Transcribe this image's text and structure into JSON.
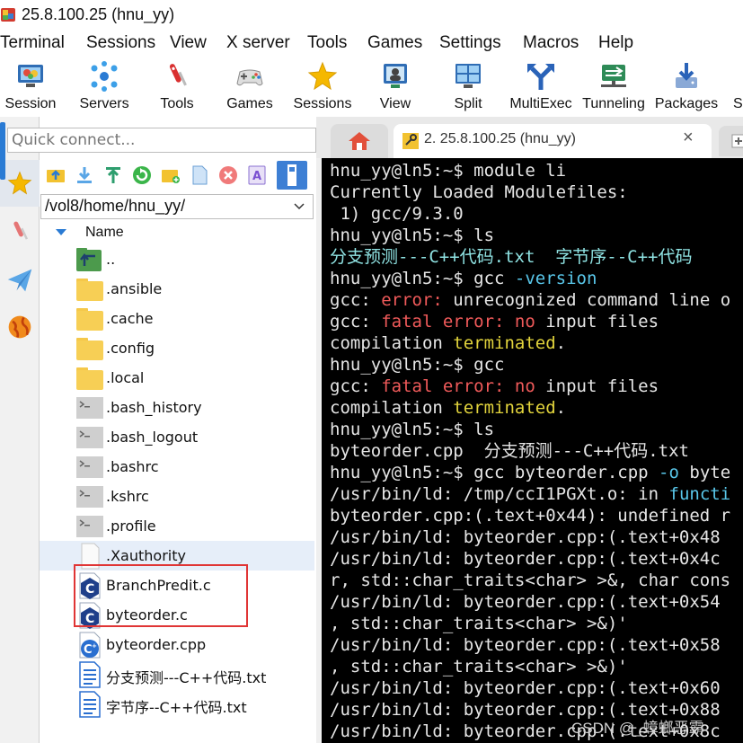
{
  "window": {
    "title": "25.8.100.25 (hnu_yy)"
  },
  "menu": [
    "Terminal",
    "Sessions",
    "View",
    "X server",
    "Tools",
    "Games",
    "Settings",
    "Macros",
    "Help"
  ],
  "toolbar": {
    "session": "Session",
    "servers": "Servers",
    "tools": "Tools",
    "games": "Games",
    "sessions": "Sessions",
    "view": "View",
    "split": "Split",
    "multiexec": "MultiExec",
    "tunneling": "Tunneling",
    "packages": "Packages",
    "more": "S"
  },
  "quick_connect": {
    "placeholder": "Quick connect..."
  },
  "file_panel": {
    "path": "/vol8/home/hnu_yy/",
    "column_header": "Name",
    "files": [
      {
        "name": "..",
        "type": "parent"
      },
      {
        "name": ".ansible",
        "type": "folder"
      },
      {
        "name": ".cache",
        "type": "folder"
      },
      {
        "name": ".config",
        "type": "folder"
      },
      {
        "name": ".local",
        "type": "folder"
      },
      {
        "name": ".bash_history",
        "type": "script"
      },
      {
        "name": ".bash_logout",
        "type": "script"
      },
      {
        "name": ".bashrc",
        "type": "script"
      },
      {
        "name": ".kshrc",
        "type": "script"
      },
      {
        "name": ".profile",
        "type": "script"
      },
      {
        "name": ".Xauthority",
        "type": "blank"
      },
      {
        "name": "BranchPredit.c",
        "type": "c"
      },
      {
        "name": "byteorder.c",
        "type": "c"
      },
      {
        "name": "byteorder.cpp",
        "type": "cpp"
      },
      {
        "name": "分支预测---C++代码.txt",
        "type": "txt"
      },
      {
        "name": "字节序--C++代码.txt",
        "type": "txt"
      }
    ]
  },
  "tabs": {
    "active_label": "2. 25.8.100.25 (hnu_yy)",
    "close_glyph": "×"
  },
  "terminal": {
    "lines": [
      [
        [
          "hnu_yy@ln5:~$ module li",
          ""
        ]
      ],
      [
        [
          "Currently Loaded Modulefiles:",
          ""
        ]
      ],
      [
        [
          " 1) gcc/9.3.0",
          ""
        ]
      ],
      [
        [
          "hnu_yy@ln5:~$ ls",
          ""
        ]
      ],
      [
        [
          "分支预测---C++代码.txt  字节序--C++代码",
          "teal"
        ]
      ],
      [
        [
          "hnu_yy@ln5:~$ gcc ",
          ""
        ],
        [
          "-version",
          "cyan"
        ]
      ],
      [
        [
          "gcc: ",
          ""
        ],
        [
          "error:",
          "red"
        ],
        [
          " unrecognized command line o",
          ""
        ]
      ],
      [
        [
          "gcc: ",
          ""
        ],
        [
          "fatal error: no",
          "red"
        ],
        [
          " input files",
          ""
        ]
      ],
      [
        [
          "compilation ",
          ""
        ],
        [
          "terminated",
          "yellow"
        ],
        [
          ".",
          ""
        ]
      ],
      [
        [
          "hnu_yy@ln5:~$ gcc",
          ""
        ]
      ],
      [
        [
          "gcc: ",
          ""
        ],
        [
          "fatal error: no",
          "red"
        ],
        [
          " input files",
          ""
        ]
      ],
      [
        [
          "compilation ",
          ""
        ],
        [
          "terminated",
          "yellow"
        ],
        [
          ".",
          ""
        ]
      ],
      [
        [
          "hnu_yy@ln5:~$ ls",
          ""
        ]
      ],
      [
        [
          "byteorder.cpp  分支预测---C++代码.txt  ",
          ""
        ]
      ],
      [
        [
          "hnu_yy@ln5:~$ gcc byteorder.cpp ",
          ""
        ],
        [
          "-o",
          "cyan"
        ],
        [
          " byte",
          ""
        ]
      ],
      [
        [
          "/usr/bin/ld: /tmp/ccI1PGXt.o: in ",
          ""
        ],
        [
          "functi",
          "cyan"
        ]
      ],
      [
        [
          "byteorder.cpp:(.text+0x44): undefined r",
          ""
        ]
      ],
      [
        [
          "/usr/bin/ld: byteorder.cpp:(.text+0x48",
          ""
        ]
      ],
      [
        [
          "/usr/bin/ld: byteorder.cpp:(.text+0x4c",
          ""
        ]
      ],
      [
        [
          "r, std::char_traits<char> >&, char cons",
          ""
        ]
      ],
      [
        [
          "/usr/bin/ld: byteorder.cpp:(.text+0x54",
          ""
        ]
      ],
      [
        [
          ", std::char_traits<char> >&)'",
          ""
        ]
      ],
      [
        [
          "/usr/bin/ld: byteorder.cpp:(.text+0x58",
          ""
        ]
      ],
      [
        [
          ", std::char_traits<char> >&)'",
          ""
        ]
      ],
      [
        [
          "/usr/bin/ld: byteorder.cpp:(.text+0x60",
          ""
        ]
      ],
      [
        [
          "/usr/bin/ld: byteorder.cpp:(.text+0x88",
          ""
        ]
      ],
      [
        [
          "/usr/bin/ld: byteorder.cpp:(.text+0x8c",
          ""
        ]
      ]
    ]
  },
  "watermark": "CSDN @_蟑螂恶霸",
  "colors": {
    "accent": "#2a7bd4",
    "highlight_box": "#e03535",
    "terminal_bg": "#000000"
  }
}
